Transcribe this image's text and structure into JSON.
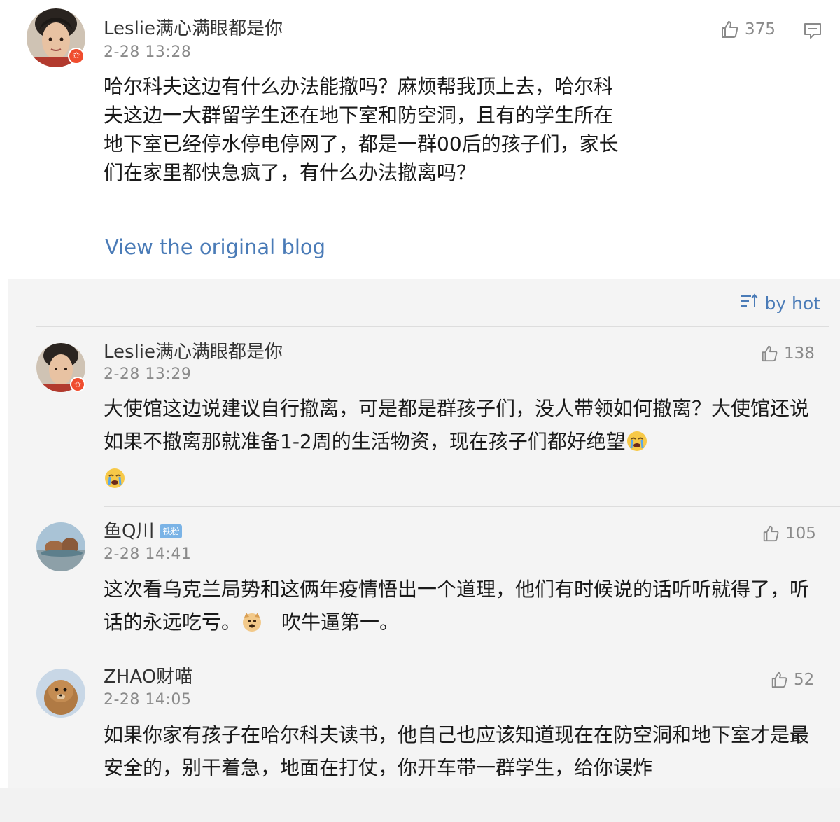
{
  "post": {
    "username": "Leslie满心满眼都是你",
    "time": "2-28 13:28",
    "likes": "375",
    "text": "哈尔科夫这边有什么办法能撤吗？麻烦帮我顶上去，哈尔科夫这边一大群留学生还在地下室和防空洞，且有的学生所在地下室已经停水停电停网了，都是一群00后的孩子们，家长们在家里都快急疯了，有什么办法撤离吗？",
    "view_original": "View the original blog",
    "verified_badge": "✩"
  },
  "sort": {
    "label": "by hot"
  },
  "comments": [
    {
      "username": "Leslie满心满眼都是你",
      "time": "2-28 13:29",
      "likes": "138",
      "text": "大使馆这边说建议自行撤离，可是都是群孩子们，没人带领如何撤离？大使馆还说如果不撤离那就准备1-2周的生活物资，现在孩子们都好绝望",
      "emoji": "crying-face"
    },
    {
      "username": "鱼Q川",
      "badge": "铁粉",
      "time": "2-28 14:41",
      "likes": "105",
      "text_a": "这次看乌克兰局势和这俩年疫情悟出一个道理，他们有时候说的话听听就得了，听话的永远吃亏。",
      "text_b": "吹牛逼第一。",
      "emoji": "doge-face"
    },
    {
      "username": "ZHAO财喵",
      "time": "2-28 14:05",
      "likes": "52",
      "text": "如果你家有孩子在哈尔科夫读书，他自己也应该知道现在在防空洞和地下室才是最安全的，别干着急，地面在打仗，你开车带一群学生，给你误炸"
    }
  ],
  "colors": {
    "link": "#4a7bb7",
    "secondary": "#8a8a8a",
    "verified": "#f04d2e"
  }
}
